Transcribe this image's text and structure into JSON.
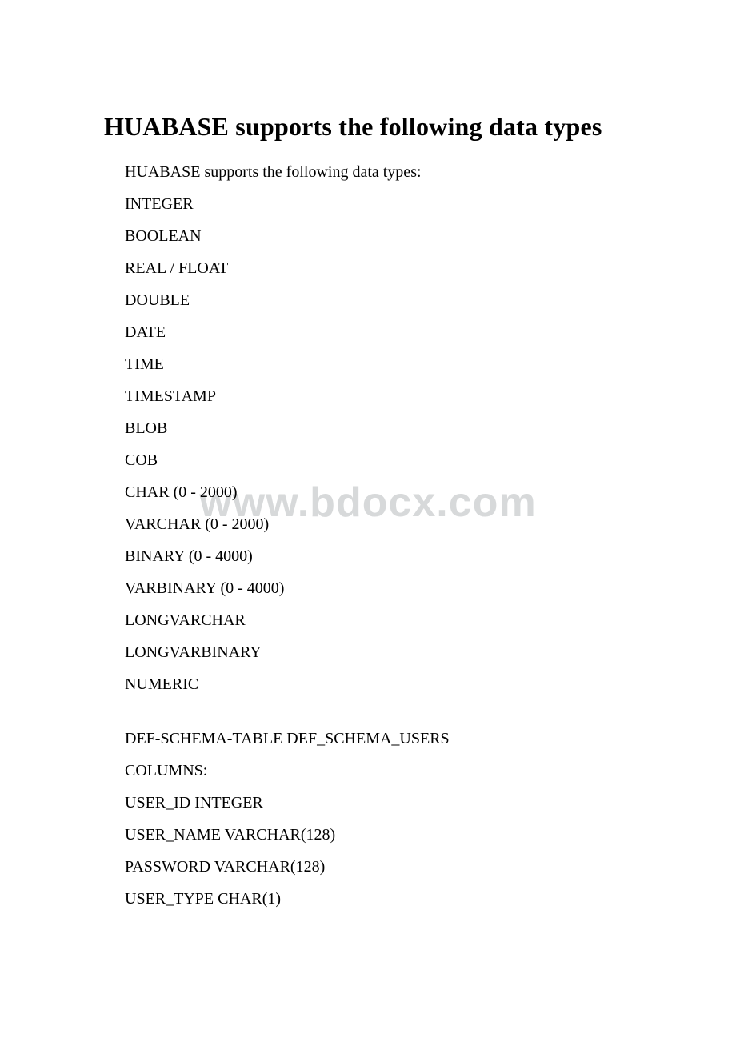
{
  "title": "HUABASE supports the following data types",
  "watermark": "www.bdocx.com",
  "lines": [
    "HUABASE supports the following data types:",
    "INTEGER",
    "BOOLEAN",
    "REAL / FLOAT",
    "DOUBLE",
    "DATE",
    "TIME",
    "TIMESTAMP",
    "BLOB",
    "COB",
    "CHAR (0 - 2000)",
    "VARCHAR (0 - 2000)",
    "BINARY (0 - 4000)",
    "VARBINARY (0 - 4000)",
    "LONGVARCHAR",
    "LONGVARBINARY",
    "NUMERIC"
  ],
  "lines2": [
    "DEF-SCHEMA-TABLE DEF_SCHEMA_USERS",
    "COLUMNS:",
    "USER_ID INTEGER",
    "USER_NAME VARCHAR(128)",
    "PASSWORD VARCHAR(128)",
    "USER_TYPE CHAR(1)"
  ]
}
